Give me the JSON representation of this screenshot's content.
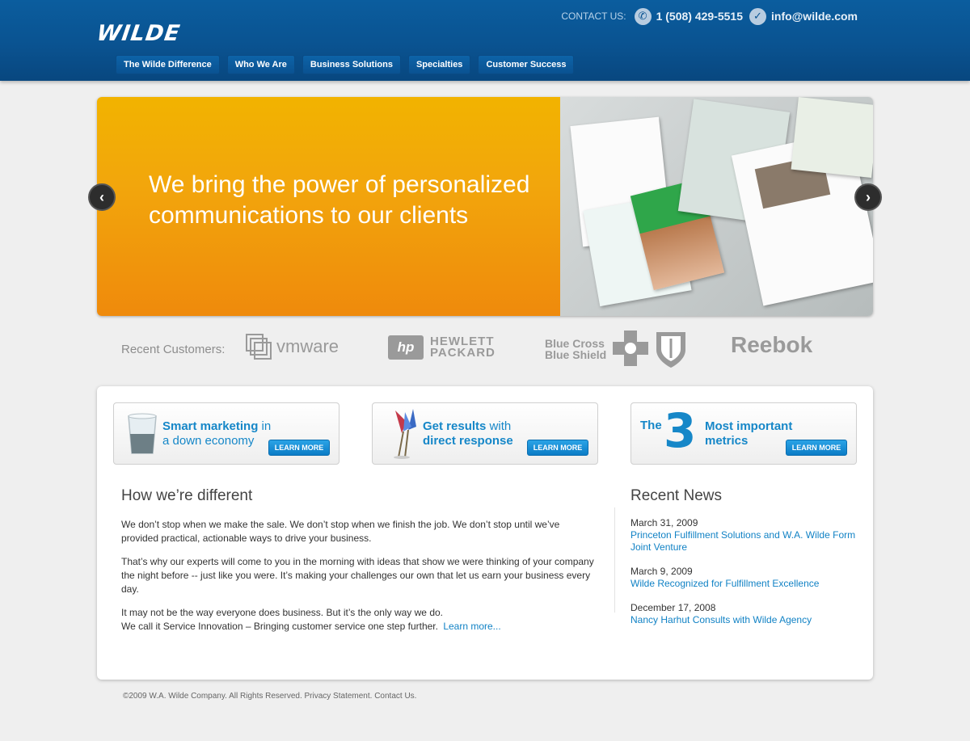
{
  "header": {
    "logo": "WILDE",
    "contact_label": "CONTACT US:",
    "phone": "1 (508) 429-5515",
    "email": "info@wilde.com",
    "phone_icon": "phone-icon",
    "email_icon": "email-icon"
  },
  "nav": {
    "items": [
      {
        "label": "The Wilde Difference"
      },
      {
        "label": "Who We Are"
      },
      {
        "label": "Business Solutions"
      },
      {
        "label": "Specialties"
      },
      {
        "label": "Customer Success"
      }
    ]
  },
  "hero": {
    "headline_line1": "We bring the power of personalized",
    "headline_line2": "communications to our clients",
    "prev_glyph": "‹",
    "next_glyph": "›"
  },
  "customers": {
    "label": "Recent Customers:",
    "logos": [
      "vmware",
      "HEWLETT",
      "PACKARD",
      "Blue Cross",
      "Blue Shield",
      "Reebok"
    ]
  },
  "promos": [
    {
      "title_bold": "Smart marketing",
      "title_rest": " in",
      "title_line2": "a down economy",
      "button": "LEARN MORE"
    },
    {
      "title_bold": "Get results",
      "title_rest": " with",
      "title_line2": "direct response",
      "button": "LEARN MORE"
    },
    {
      "title_pre": "The",
      "number": "3",
      "title_line1": "Most important",
      "title_line2": "metrics",
      "button": "LEARN MORE"
    }
  ],
  "how": {
    "heading": "How we’re different",
    "p1": "We don’t stop when we make the sale. We don’t stop when we finish the job. We don’t stop until we’ve provided practical, actionable ways to drive your business.",
    "p2": "That’s why our experts will come to you in the morning with ideas that show we were thinking of your company the night before -- just like you were.  It’s making your challenges our own that let us earn your business every day.",
    "p3_line1": "It may not be the way everyone does business. But it’s the only way we do.",
    "p3_line2": "We call it Service Innovation – Bringing customer service one step further.",
    "learn_more": "Learn more..."
  },
  "news": {
    "heading": "Recent News",
    "items": [
      {
        "date": "March 31, 2009",
        "title": "Princeton Fulfillment Solutions and W.A. Wilde Form Joint Venture"
      },
      {
        "date": "March 9, 2009",
        "title": "Wilde Recognized for Fulfillment Excellence"
      },
      {
        "date": "December 17, 2008",
        "title": "Nancy Harhut Consults with Wilde Agency"
      }
    ]
  },
  "footer": {
    "text": "©2009 W.A. Wilde Company. All Rights Reserved. Privacy Statement. Contact Us."
  },
  "colors": {
    "header_blue": "#0a5391",
    "hero_orange": "#f2a60c",
    "link_blue": "#1182c5",
    "accent_blue": "#1687c8"
  }
}
